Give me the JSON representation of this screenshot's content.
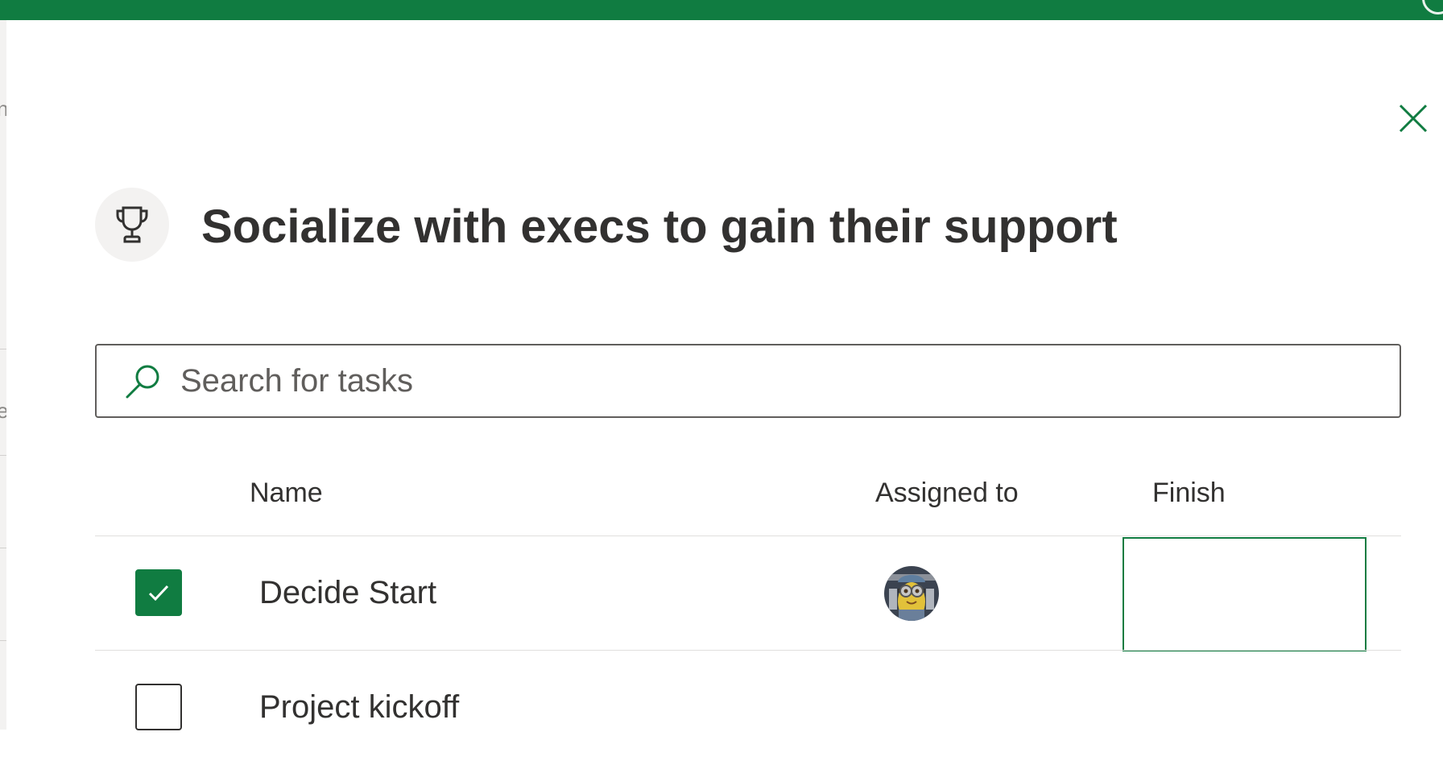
{
  "app": {
    "accent_color": "#107c41"
  },
  "dialog": {
    "title": "Socialize with execs to gain their support",
    "title_icon": "trophy-icon",
    "close_icon": "close-icon"
  },
  "search": {
    "placeholder": "Search for tasks",
    "value": "",
    "icon": "search-icon"
  },
  "table": {
    "headers": {
      "name": "Name",
      "assigned_to": "Assigned to",
      "finish": "Finish"
    },
    "rows": [
      {
        "name": "Decide Start",
        "completed": true,
        "assignee_avatar": "user-avatar",
        "finish": ""
      },
      {
        "name": "Project kickoff",
        "completed": false,
        "assignee_avatar": "",
        "finish": ""
      }
    ]
  }
}
